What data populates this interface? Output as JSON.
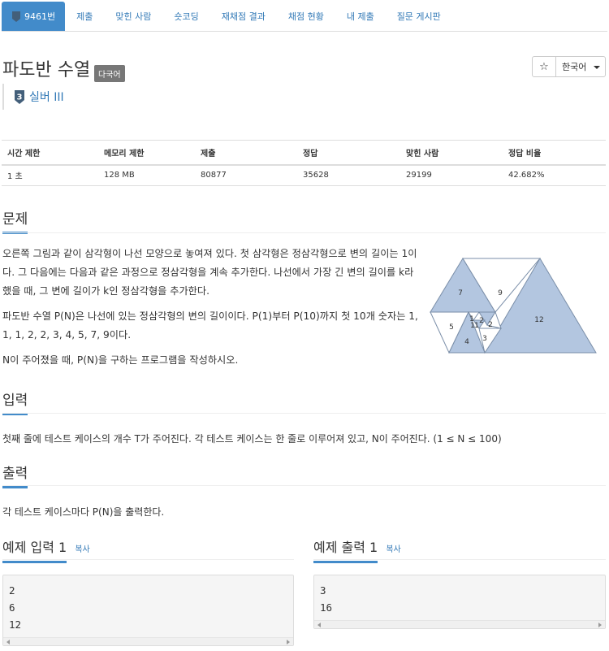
{
  "nav": {
    "tabs": [
      {
        "label": "9461번",
        "tier": "3",
        "active": true
      },
      {
        "label": "제출"
      },
      {
        "label": "맞힌 사람"
      },
      {
        "label": "숏코딩"
      },
      {
        "label": "재채점 결과"
      },
      {
        "label": "채점 현황"
      },
      {
        "label": "내 제출"
      },
      {
        "label": "질문 게시판"
      }
    ]
  },
  "problem": {
    "title": "파도반 수열",
    "language_tag": "다국어",
    "tier_number": "3",
    "tier_label": "실버 III"
  },
  "toolbar": {
    "star": "☆",
    "language": "한국어"
  },
  "info_table": {
    "headers": [
      "시간 제한",
      "메모리 제한",
      "제출",
      "정답",
      "맞힌 사람",
      "정답 비율"
    ],
    "row": [
      "1 초",
      "128 MB",
      "80877",
      "35628",
      "29199",
      "42.682%"
    ]
  },
  "sections": {
    "problem_head": "문제",
    "input_head": "입력",
    "output_head": "출력"
  },
  "problem_body": {
    "p1": "오른쪽 그림과 같이 삼각형이 나선 모양으로 놓여져 있다. 첫 삼각형은 정삼각형으로 변의 길이는 1이다. 그 다음에는 다음과 같은 과정으로 정삼각형을 계속 추가한다. 나선에서 가장 긴 변의 길이를 k라 했을 때, 그 변에 길이가 k인 정삼각형을 추가한다.",
    "p2": "파도반 수열 P(N)은 나선에 있는 정삼각형의 변의 길이이다. P(1)부터 P(10)까지 첫 10개 숫자는 1, 1, 1, 2, 2, 3, 4, 5, 7, 9이다.",
    "p3": "N이 주어졌을 때, P(N)을 구하는 프로그램을 작성하시오."
  },
  "figure": {
    "labels": [
      "7",
      "9",
      "12",
      "5",
      "1",
      "2",
      "1",
      "1",
      "2",
      "3",
      "4"
    ],
    "fill_color": "#b3c6e0",
    "stroke_color": "#7a8ea8"
  },
  "input_text": "첫째 줄에 테스트 케이스의 개수 T가 주어진다. 각 테스트 케이스는 한 줄로 이루어져 있고, N이 주어진다. (1 ≤ N ≤ 100)",
  "output_text": "각 테스트 케이스마다 P(N)을 출력한다.",
  "samples": {
    "input": {
      "title": "예제 입력 1",
      "copy": "복사",
      "lines": [
        "2",
        "6",
        "12"
      ]
    },
    "output": {
      "title": "예제 출력 1",
      "copy": "복사",
      "lines": [
        "3",
        "16"
      ]
    }
  },
  "colors": {
    "accent": "#428bca",
    "link": "#337ab7"
  }
}
